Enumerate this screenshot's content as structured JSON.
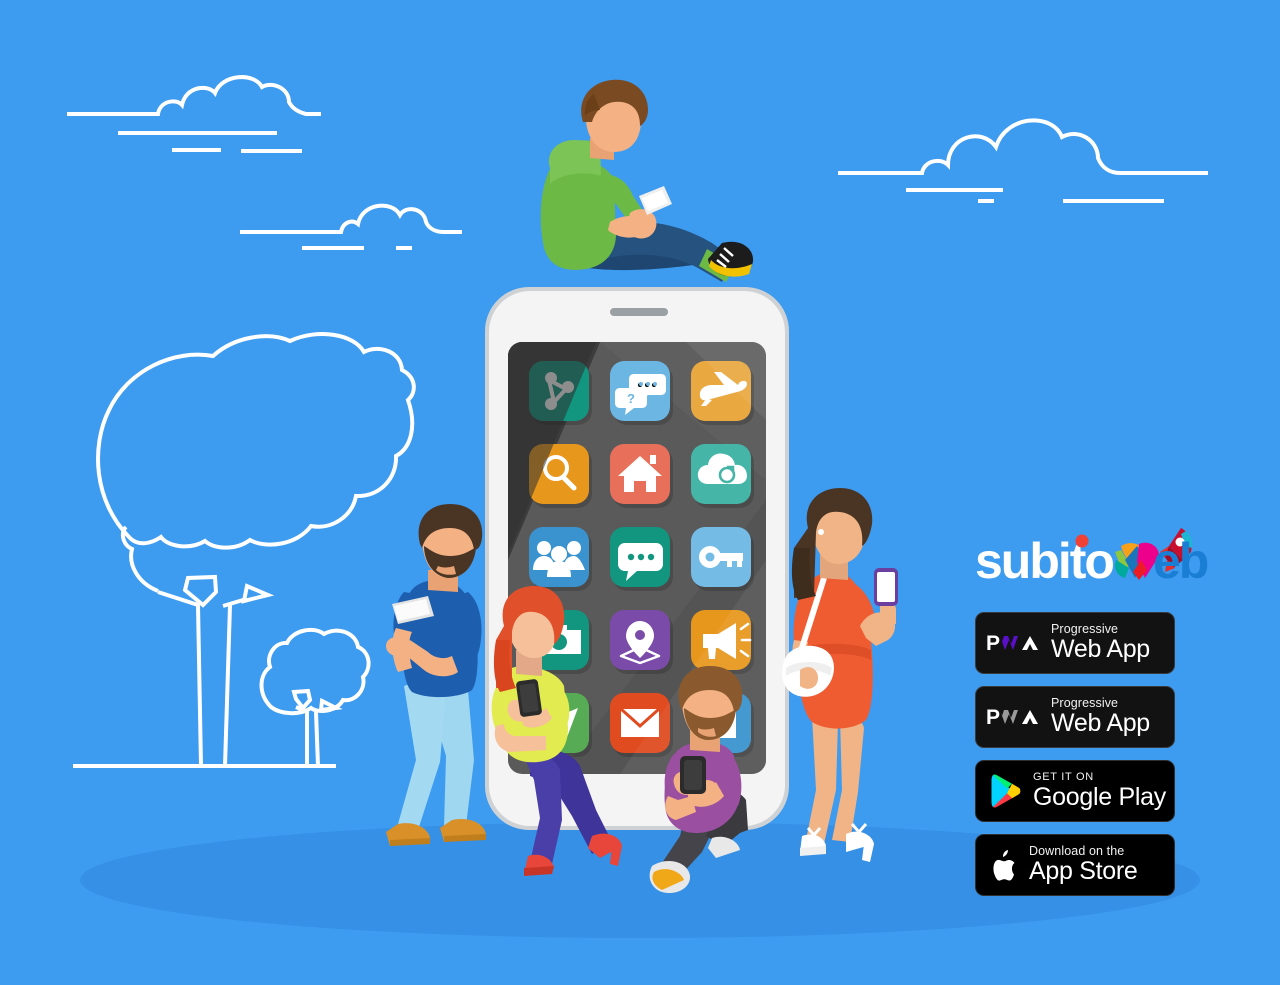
{
  "scene": {
    "title": "Progressive Web App promotional illustration",
    "background_color": "#3d9bf0",
    "ground_shadow_color": "#3590e6"
  },
  "brand": {
    "logo_text_primary": "subito",
    "logo_text_secondary": "web",
    "logo_primary_color": "#ffffff",
    "logo_secondary_color": "#1a7fd4",
    "logo_dot_color": "#ef4136",
    "rocket_color": "#c8102e"
  },
  "badges": [
    {
      "name": "pwa-purple",
      "mark": "PWA",
      "mark_letters": {
        "p": "P",
        "w": "W",
        "a": "A"
      },
      "accent_color": "#5a0fc8",
      "line_small": "Progressive",
      "line_big": "Web App",
      "background": "#121212"
    },
    {
      "name": "pwa-grey",
      "mark": "PWA",
      "mark_letters": {
        "p": "P",
        "w": "W",
        "a": "A"
      },
      "accent_color": "#9a9a9a",
      "line_small": "Progressive",
      "line_big": "Web App",
      "background": "#121212"
    },
    {
      "name": "google-play",
      "mark": "play-triangle-icon",
      "line_small": "GET IT ON",
      "line_big": "Google Play",
      "background": "#000000",
      "icon_colors": [
        "#00d3ff",
        "#00f076",
        "#ffce00",
        "#ff3a44"
      ]
    },
    {
      "name": "app-store",
      "mark": "apple-icon",
      "line_small": "Download on the",
      "line_big": "App Store",
      "background": "#000000",
      "icon_colors": [
        "#ffffff"
      ]
    }
  ],
  "phone": {
    "body_color": "#f2f2f2",
    "frame_color": "#cfd2d4",
    "screen_color": "#5a5a5a",
    "screen_dark_color": "#3c3c3c",
    "speaker_color": "#9aa0a4",
    "app_icons": [
      {
        "row": 1,
        "col": 1,
        "name": "share-icon",
        "color": "#12967f"
      },
      {
        "row": 1,
        "col": 2,
        "name": "chat-question-icon",
        "color": "#6cb6e3"
      },
      {
        "row": 1,
        "col": 3,
        "name": "airplane-icon",
        "color": "#eaa841"
      },
      {
        "row": 2,
        "col": 1,
        "name": "search-icon",
        "color": "#e8971d"
      },
      {
        "row": 2,
        "col": 2,
        "name": "home-icon",
        "color": "#e8705a"
      },
      {
        "row": 2,
        "col": 3,
        "name": "cloud-sync-icon",
        "color": "#45b5a8"
      },
      {
        "row": 3,
        "col": 1,
        "name": "users-icon",
        "color": "#3a93cf"
      },
      {
        "row": 3,
        "col": 2,
        "name": "chat-bubble-icon",
        "color": "#12967f"
      },
      {
        "row": 3,
        "col": 3,
        "name": "key-icon",
        "color": "#74bce6"
      },
      {
        "row": 4,
        "col": 1,
        "name": "camera-icon",
        "color": "#12967f"
      },
      {
        "row": 4,
        "col": 2,
        "name": "map-pin-icon",
        "color": "#7a4ba8"
      },
      {
        "row": 4,
        "col": 3,
        "name": "megaphone-icon",
        "color": "#e8971d"
      },
      {
        "row": 5,
        "col": 1,
        "name": "send-icon",
        "color": "#56ab54"
      },
      {
        "row": 5,
        "col": 2,
        "name": "mail-icon",
        "color": "#e04b20"
      },
      {
        "row": 5,
        "col": 3,
        "name": "contacts-icon",
        "color": "#3a93cf"
      }
    ]
  },
  "characters": [
    {
      "name": "man-on-top-of-phone",
      "pose": "sitting on phone top, using smartphone",
      "colors": {
        "hair": "#7a4a22",
        "skin": "#f4b183",
        "top": "#6cba45",
        "pants": "#25527e",
        "shoes": "#1c1c1c",
        "shoe_accent": "#f2c200"
      }
    },
    {
      "name": "bearded-man-left",
      "pose": "standing, leaning on phone, using smartphone",
      "colors": {
        "hair": "#4a3524",
        "skin": "#f4b183",
        "top": "#1d5fae",
        "pants": "#a4d9f2",
        "shoes": "#d99029"
      }
    },
    {
      "name": "seated-woman",
      "pose": "sitting on phone base, using smartphone",
      "colors": {
        "hair": "#e0502a",
        "skin": "#f6c09a",
        "top": "#e2eb4f",
        "pants": "#4a3fa8",
        "shoes": "#e8463a"
      }
    },
    {
      "name": "purple-shirt-man",
      "pose": "sitting on ground, using smartphone",
      "colors": {
        "hair": "#8a5a2e",
        "skin": "#f4b183",
        "top": "#9a4fa0",
        "pants": "#3a3a3f",
        "shoes": "#e8e8e8",
        "shoe_accent": "#f0a818"
      }
    },
    {
      "name": "standing-woman-right",
      "pose": "standing, using smartphone, carrying handbag",
      "colors": {
        "hair": "#4a3524",
        "skin": "#f0b487",
        "dress": "#f05c32",
        "bag": "#ffffff",
        "shoes": "#ffffff"
      }
    }
  ],
  "background_elements": [
    {
      "name": "cloud-top-left",
      "type": "outline-cloud"
    },
    {
      "name": "cloud-mid-left",
      "type": "outline-cloud"
    },
    {
      "name": "cloud-top-right",
      "type": "outline-cloud"
    },
    {
      "name": "tree-large",
      "type": "outline-tree"
    },
    {
      "name": "tree-small",
      "type": "outline-tree"
    },
    {
      "name": "ground-line",
      "type": "outline-line"
    }
  ]
}
